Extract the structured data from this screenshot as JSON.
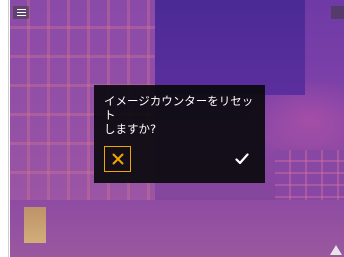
{
  "dialog": {
    "message": "イメージカウンターをリセット\nしますか?",
    "cancel_icon": "close-icon",
    "confirm_icon": "check-icon"
  },
  "toolbar": {
    "menu_icon": "menu-icon",
    "warning_icon": "warning-icon"
  },
  "colors": {
    "accent": "#f0a500",
    "dialog_bg": "#0a0a0e",
    "thermal_base": "#7a3fa8"
  }
}
